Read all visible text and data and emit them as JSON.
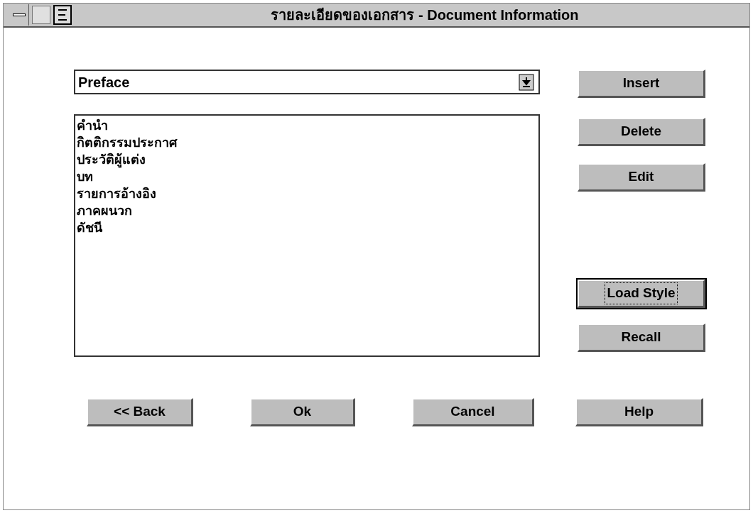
{
  "window": {
    "title": "รายละเอียดของเอกสาร - Document Information"
  },
  "section_dropdown": {
    "value": "Preface"
  },
  "list": {
    "items": [
      {
        "label": "คำนำ",
        "selected": false
      },
      {
        "label": "กิตติกรรมประกาศ",
        "selected": false
      },
      {
        "label": "ประวัติผู้แต่ง",
        "selected": false
      },
      {
        "label": "บท",
        "selected": false
      },
      {
        "label": "รายการอ้างอิง",
        "selected": false
      },
      {
        "label": "ภาคผนวก",
        "selected": false
      },
      {
        "label": "ดัชนี",
        "selected": false
      }
    ]
  },
  "side_buttons": [
    {
      "label": "Insert",
      "focused": false
    },
    {
      "label": "Delete",
      "focused": false
    },
    {
      "label": "Edit",
      "focused": false
    },
    {
      "label": "Load Style",
      "focused": true
    },
    {
      "label": "Recall",
      "focused": false
    }
  ],
  "bottom_buttons": [
    {
      "label": "<< Back",
      "focused": false
    },
    {
      "label": "Ok",
      "focused": false
    },
    {
      "label": "Cancel",
      "focused": false
    },
    {
      "label": "Help",
      "focused": false
    }
  ]
}
